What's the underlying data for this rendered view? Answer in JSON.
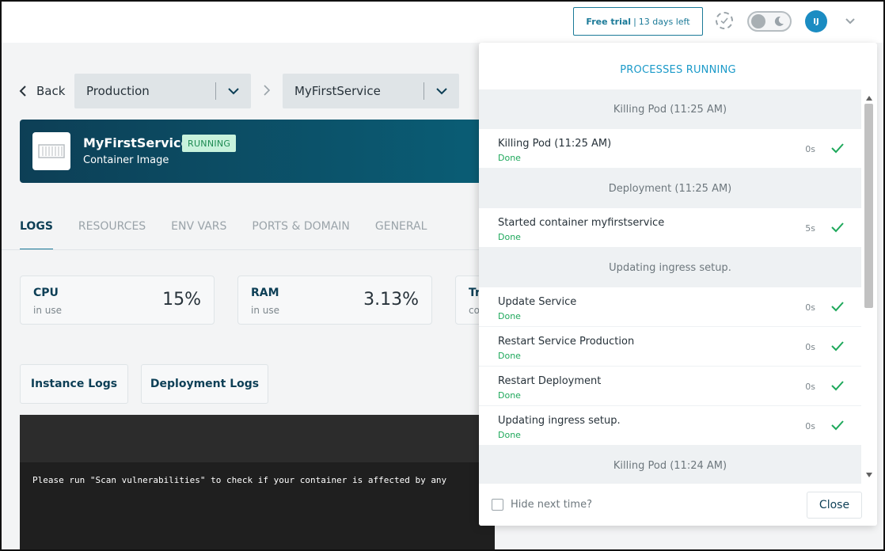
{
  "header": {
    "trial_strong": "Free trial",
    "trial_sep": "|",
    "trial_rest": "13 days left",
    "avatar_initials": "IJ"
  },
  "breadcrumb": {
    "back_label": "Back",
    "environment": "Production",
    "service": "MyFirstService"
  },
  "service": {
    "name": "MyFirstService",
    "status": "RUNNING",
    "type": "Container Image"
  },
  "tabs": [
    {
      "label": "LOGS",
      "active": true
    },
    {
      "label": "RESOURCES",
      "active": false
    },
    {
      "label": "ENV VARS",
      "active": false
    },
    {
      "label": "PORTS & DOMAIN",
      "active": false
    },
    {
      "label": "GENERAL",
      "active": false
    }
  ],
  "metrics": [
    {
      "label": "CPU",
      "sub": "in use",
      "value": "15%"
    },
    {
      "label": "RAM",
      "sub": "in use",
      "value": "3.13%"
    },
    {
      "label": "Tr",
      "sub": "co",
      "value": ""
    }
  ],
  "log_buttons": {
    "instance": "Instance Logs",
    "deployment": "Deployment Logs"
  },
  "terminal": {
    "line": "Please run \"Scan vulnerabilities\" to check if your container is affected by any"
  },
  "processes": {
    "title": "PROCESSES RUNNING",
    "groups": [
      {
        "title": "Killing Pod (11:25 AM)",
        "items": [
          {
            "name": "Killing Pod (11:25 AM)",
            "status": "Done",
            "time": "0s"
          }
        ]
      },
      {
        "title": "Deployment (11:25 AM)",
        "items": [
          {
            "name": "Started container myfirstservice",
            "status": "Done",
            "time": "5s"
          }
        ]
      },
      {
        "title": "Updating ingress setup.",
        "items": [
          {
            "name": "Update Service",
            "status": "Done",
            "time": "0s"
          },
          {
            "name": "Restart Service Production",
            "status": "Done",
            "time": "0s"
          },
          {
            "name": "Restart Deployment",
            "status": "Done",
            "time": "0s"
          },
          {
            "name": "Updating ingress setup.",
            "status": "Done",
            "time": "0s"
          }
        ]
      },
      {
        "title": "Killing Pod (11:24 AM)",
        "items": []
      }
    ],
    "hide_label": "Hide next time?",
    "close_label": "Close"
  },
  "colors": {
    "accent": "#1b7a98",
    "success": "#1ea85b",
    "header_dark": "#0d3f56"
  }
}
